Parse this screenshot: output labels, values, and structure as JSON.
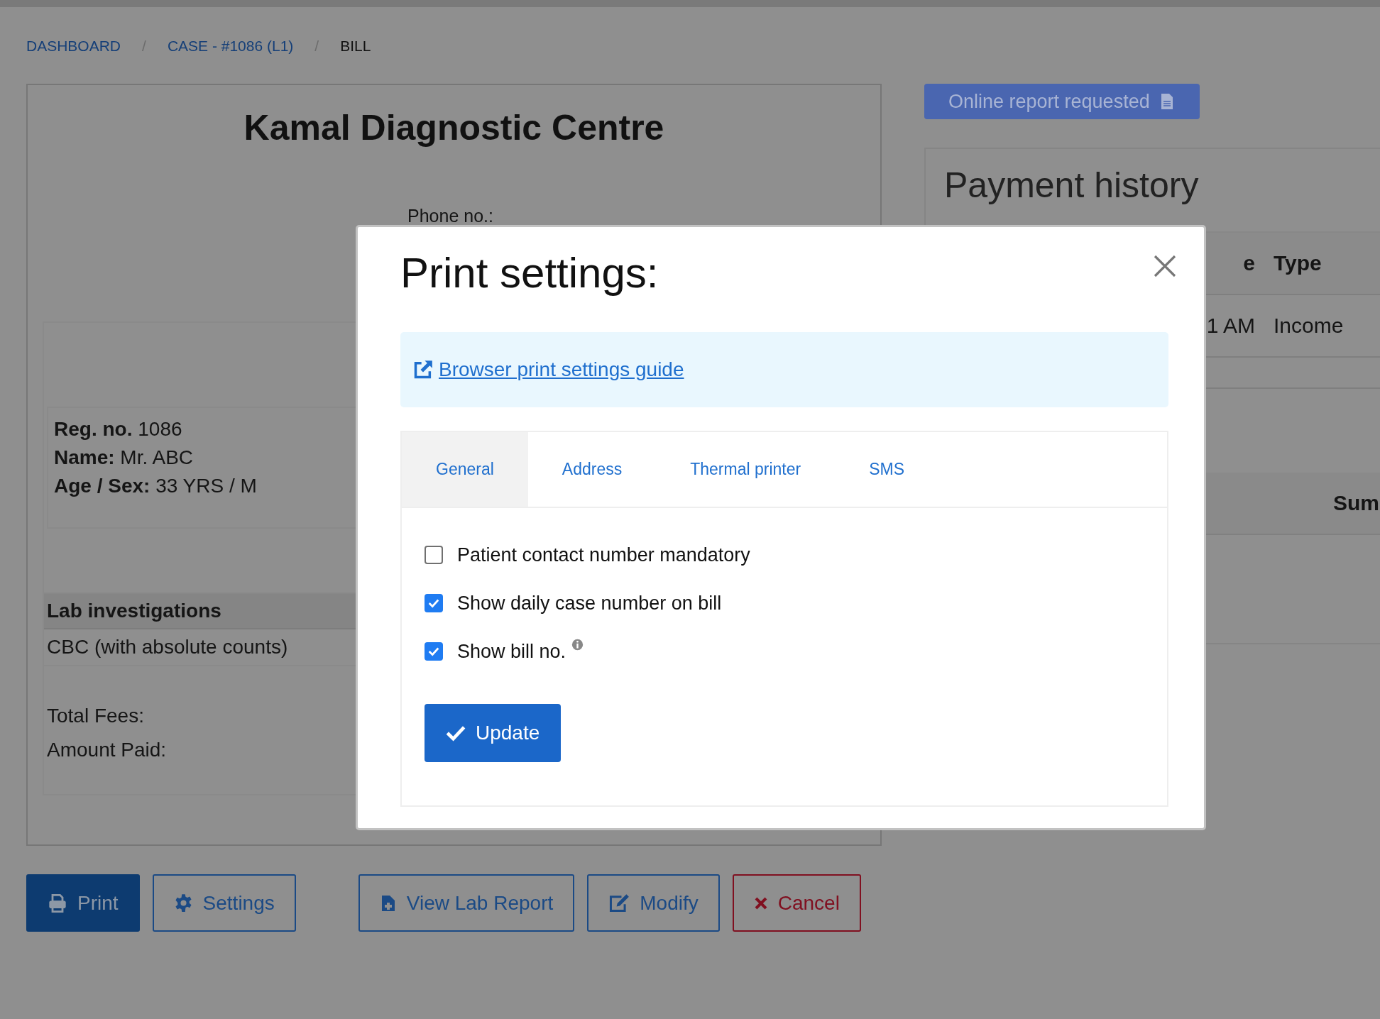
{
  "breadcrumb": {
    "separator": "/",
    "items": [
      {
        "label": "DASHBOARD",
        "kind": "link"
      },
      {
        "label": "CASE - #1086 (L1)",
        "kind": "link"
      },
      {
        "label": "BILL",
        "kind": "current"
      }
    ]
  },
  "bill": {
    "clinic_name": "Kamal Diagnostic Centre",
    "phone_label": "Phone no.:",
    "patient": [
      {
        "label": "Reg. no.",
        "value": "1086"
      },
      {
        "label": "Name:",
        "value": "Mr. ABC"
      },
      {
        "label": "Age / Sex:",
        "value": "33 YRS / M"
      }
    ],
    "investigations_heading": "Lab investigations",
    "investigations": [
      "CBC (with absolute counts)"
    ],
    "totals": [
      "Total Fees:",
      "Amount Paid:"
    ]
  },
  "actions": [
    {
      "label": "Print",
      "kind": "primary"
    },
    {
      "label": "Settings",
      "kind": "outline"
    },
    {
      "label": "View Lab Report",
      "kind": "outline"
    },
    {
      "label": "Modify",
      "kind": "outline"
    },
    {
      "label": "Cancel",
      "kind": "danger"
    }
  ],
  "online_report_button": "Online report requested",
  "payment_history": {
    "title": "Payment history",
    "columns": [
      "e",
      "Type"
    ],
    "rows": [
      [
        "1 AM",
        "Income"
      ]
    ],
    "summary_columns": [
      "Sum"
    ]
  },
  "modal": {
    "title": "Print settings:",
    "guide_link": "Browser print settings guide",
    "tabs": [
      {
        "label": "General",
        "selected": true
      },
      {
        "label": "Address",
        "selected": false
      },
      {
        "label": "Thermal printer",
        "selected": false
      },
      {
        "label": "SMS",
        "selected": false
      }
    ],
    "options": [
      {
        "label": "Patient contact number mandatory",
        "checked": false,
        "info": false
      },
      {
        "label": "Show daily case number on bill",
        "checked": true,
        "info": false
      },
      {
        "label": "Show bill no.",
        "checked": true,
        "info": true
      }
    ],
    "submit": "Update"
  }
}
